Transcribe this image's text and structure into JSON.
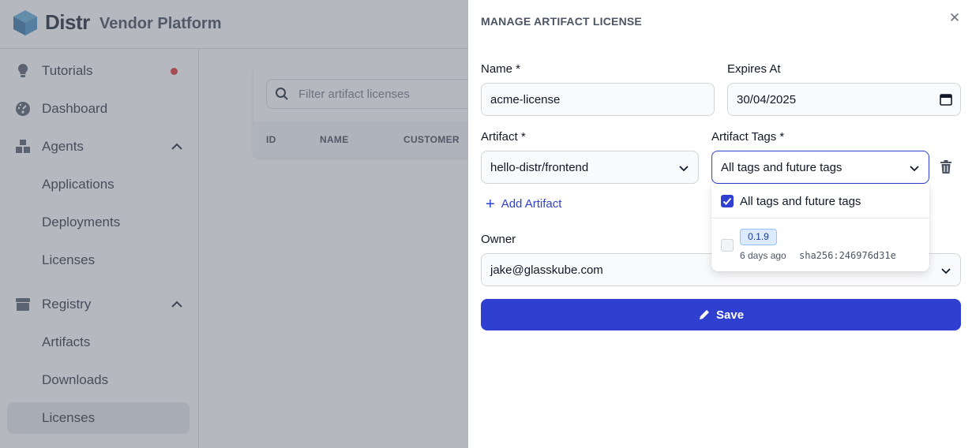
{
  "app": {
    "brand": "Distr",
    "subtitle": "Vendor Platform"
  },
  "sidebar": {
    "items": [
      {
        "label": "Tutorials",
        "icon": "lightbulb-icon",
        "badge": "notification-dot"
      },
      {
        "label": "Dashboard",
        "icon": "gauge-icon"
      },
      {
        "label": "Agents",
        "icon": "boxes-icon",
        "expanded": true
      },
      {
        "label": "Applications"
      },
      {
        "label": "Deployments"
      },
      {
        "label": "Licenses"
      },
      {
        "label": "Registry",
        "icon": "archive-icon",
        "expanded": true
      },
      {
        "label": "Artifacts"
      },
      {
        "label": "Downloads"
      },
      {
        "label": "Licenses",
        "active": true
      }
    ]
  },
  "content": {
    "filter_placeholder": "Filter artifact licenses",
    "columns": [
      "ID",
      "NAME",
      "CUSTOMER"
    ]
  },
  "drawer": {
    "title": "MANAGE ARTIFACT LICENSE",
    "name_label": "Name *",
    "name_value": "acme-license",
    "expires_label": "Expires At",
    "expires_value": "30/04/2025",
    "artifact_label": "Artifact *",
    "artifact_value": "hello-distr/frontend",
    "tags_label": "Artifact Tags *",
    "tags_value": "All tags and future tags",
    "add_artifact": "Add Artifact",
    "owner_label": "Owner",
    "owner_value": "jake@glasskube.com",
    "save_label": "Save",
    "dropdown": {
      "all_option": "All tags and future tags",
      "all_checked": true,
      "tag": {
        "name": "0.1.9",
        "age": "6 days ago",
        "digest": "sha256:246976d31e",
        "checked": false
      }
    }
  },
  "colors": {
    "accent": "#2f3fd0",
    "overlay": "#6b7280",
    "badge_dot": "#dc2626"
  }
}
